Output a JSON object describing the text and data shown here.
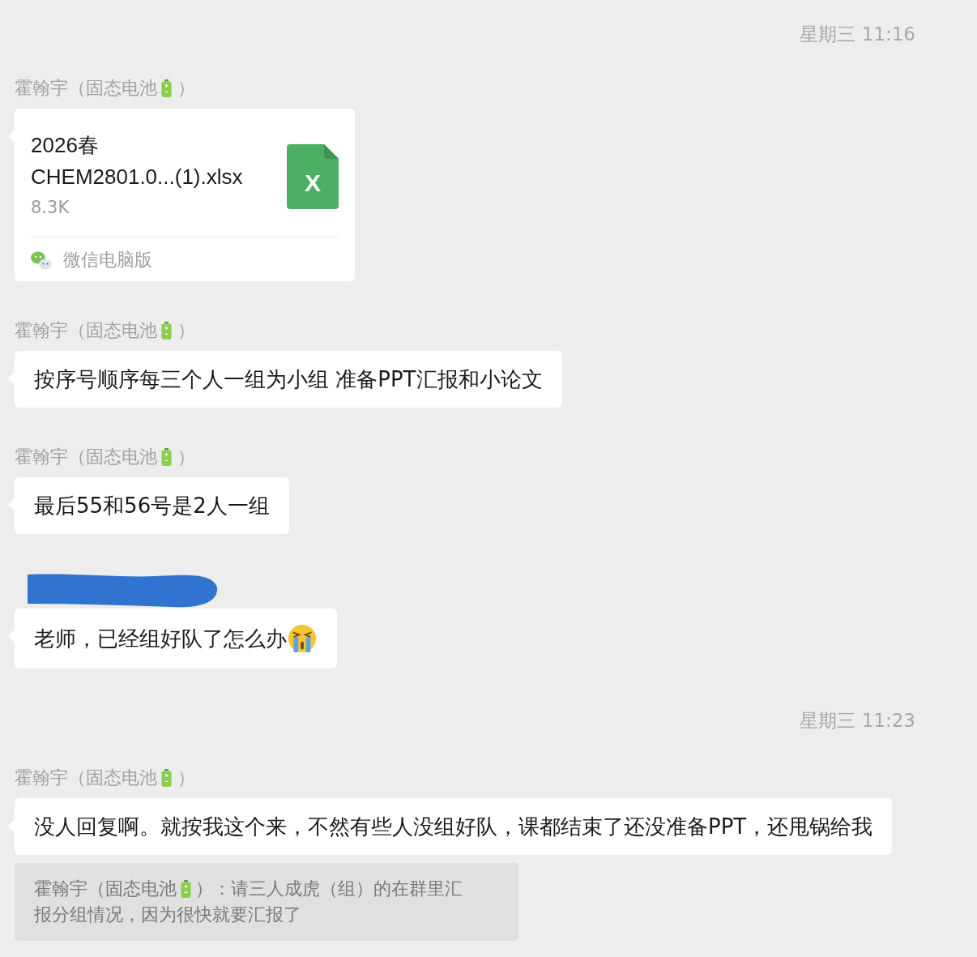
{
  "chat": {
    "items": [
      {
        "kind": "time",
        "text": "星期三 11:16"
      },
      {
        "kind": "file",
        "sender": {
          "redacted": false,
          "name": "霍翰宇（固态电池",
          "suffix": "）"
        },
        "file": {
          "name_lines": [
            "2026春",
            "CHEM2801.0...(1).xlsx"
          ],
          "size": "8.3K",
          "icon_label": "X",
          "source": "微信电脑版"
        }
      },
      {
        "kind": "text",
        "sender": {
          "redacted": false,
          "name": "霍翰宇（固态电池",
          "suffix": "）"
        },
        "text": "按序号顺序每三个人一组为小组 准备PPT汇报和小论文"
      },
      {
        "kind": "text",
        "sender": {
          "redacted": false,
          "name": "霍翰宇（固态电池",
          "suffix": "）"
        },
        "text": "最后55和56号是2人一组"
      },
      {
        "kind": "text",
        "sender": {
          "redacted": true
        },
        "text": "老师，已经组好队了怎么办",
        "has_emoji": true
      },
      {
        "kind": "time",
        "text": "星期三 11:23"
      },
      {
        "kind": "text",
        "sender": {
          "redacted": false,
          "name": "霍翰宇（固态电池",
          "suffix": "）"
        },
        "text": "没人回复啊。就按我这个来，不然有些人没组好队，课都结束了还没准备PPT，还甩锅给我",
        "quote": {
          "name": "霍翰宇（固态电池",
          "lines": [
            "）：请三人成虎（组）的在群里汇",
            "报分组情况，因为很快就要汇报了"
          ]
        }
      }
    ]
  }
}
